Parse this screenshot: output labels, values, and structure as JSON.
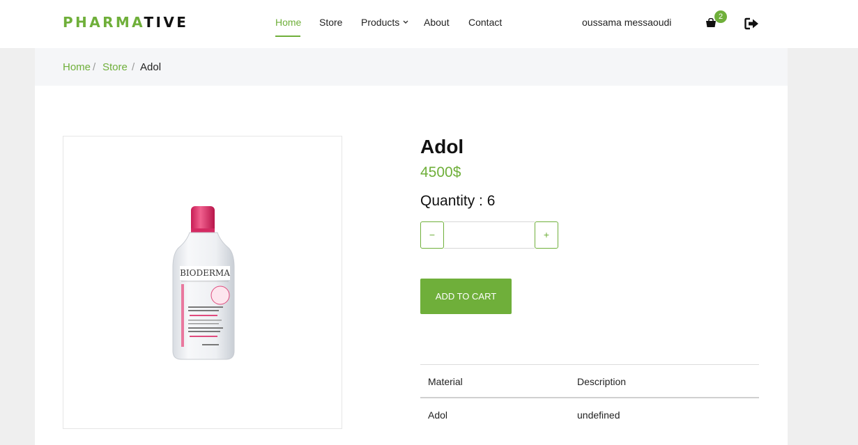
{
  "brand": {
    "part1": "PHARMA",
    "part2": "TIVE"
  },
  "nav": {
    "home": "Home",
    "store": "Store",
    "products": "Products",
    "about": "About",
    "contact": "Contact"
  },
  "user": {
    "name": "oussama messaoudi"
  },
  "cart": {
    "count": "2",
    "icon": "cart-icon"
  },
  "breadcrumb": {
    "home": "Home",
    "store": "Store",
    "current": "Adol",
    "separator": "/"
  },
  "product": {
    "title": "Adol",
    "price": "4500$",
    "quantity_label": "Quantity : 6",
    "quantity_value": "",
    "add_to_cart": "ADD TO CART"
  },
  "stepper": {
    "minus": "−",
    "plus": "+"
  },
  "details_table": {
    "headers": [
      "Material",
      "Description"
    ],
    "rows": [
      [
        "Adol",
        "undefined"
      ]
    ]
  },
  "colors": {
    "accent": "#6faf3a",
    "text": "#111111",
    "breadcrumb_bg": "#f5f6f8",
    "page_bg": "#efefef"
  }
}
